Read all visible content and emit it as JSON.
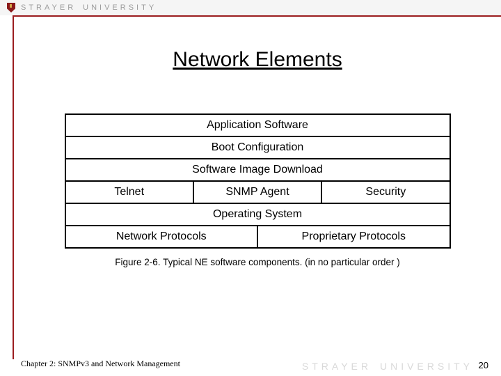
{
  "brand": {
    "name1": "STRAYER",
    "name2": "UNIVERSITY"
  },
  "title": "Network Elements",
  "rows": [
    [
      "Application Software"
    ],
    [
      "Boot Configuration"
    ],
    [
      "Software Image Download"
    ],
    [
      "Telnet",
      "SNMP Agent",
      "Security"
    ],
    [
      "Operating System"
    ],
    [
      "Network Protocols",
      "Proprietary Protocols"
    ]
  ],
  "caption": "Figure 2-6. Typical NE software components. (in no particular order )",
  "footer": "Chapter 2: SNMPv3 and Network Management",
  "page": "20"
}
